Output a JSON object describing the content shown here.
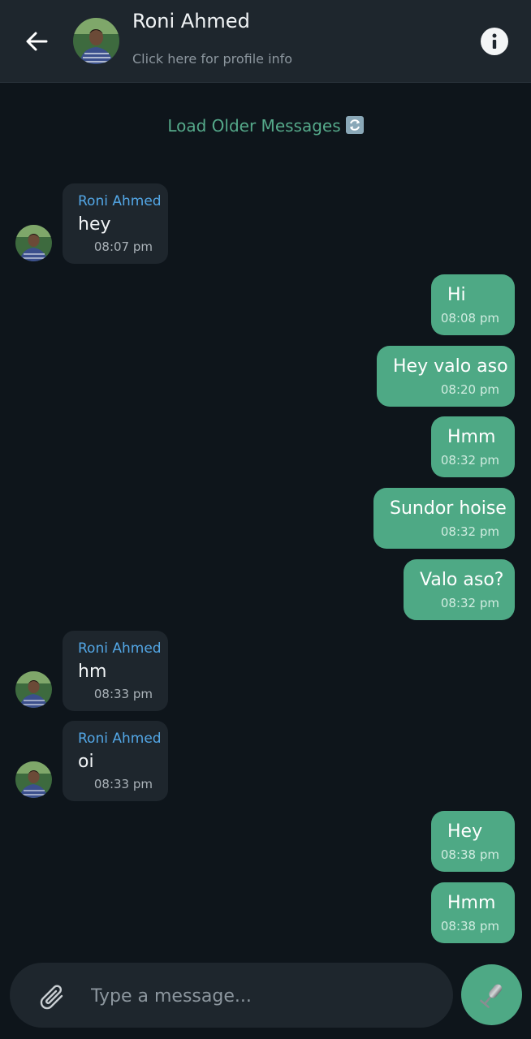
{
  "header": {
    "contact_name": "Roni Ahmed",
    "subtitle": "Click here for profile info",
    "icons": {
      "back": "arrow-left-icon",
      "info": "info-icon"
    }
  },
  "load_older": {
    "label": "Load Older Messages",
    "icon": "refresh-icon"
  },
  "messages": [
    {
      "direction": "in",
      "sender": "Roni Ahmed",
      "text": "hey",
      "time": "08:07 pm"
    },
    {
      "direction": "out",
      "text": "Hi",
      "time": "08:08 pm"
    },
    {
      "direction": "out",
      "text": "Hey valo aso",
      "time": "08:20 pm"
    },
    {
      "direction": "out",
      "text": "Hmm",
      "time": "08:32 pm"
    },
    {
      "direction": "out",
      "text": "Sundor hoise",
      "time": "08:32 pm"
    },
    {
      "direction": "out",
      "text": "Valo aso?",
      "time": "08:32 pm"
    },
    {
      "direction": "in",
      "sender": "Roni Ahmed",
      "text": "hm",
      "time": "08:33 pm"
    },
    {
      "direction": "in",
      "sender": "Roni Ahmed",
      "text": "oi",
      "time": "08:33 pm"
    },
    {
      "direction": "out",
      "text": "Hey",
      "time": "08:38 pm"
    },
    {
      "direction": "out",
      "text": "Hmm",
      "time": "08:38 pm"
    }
  ],
  "composer": {
    "placeholder": "Type a message...",
    "value": "",
    "icons": {
      "attach": "paperclip-icon",
      "mic": "microphone-icon"
    }
  },
  "colors": {
    "background": "#0e151b",
    "header": "#1e262d",
    "incoming_bubble": "#1e262d",
    "outgoing_bubble": "#4ea985",
    "sender_name": "#53a7e6",
    "accent": "#55a98a"
  }
}
